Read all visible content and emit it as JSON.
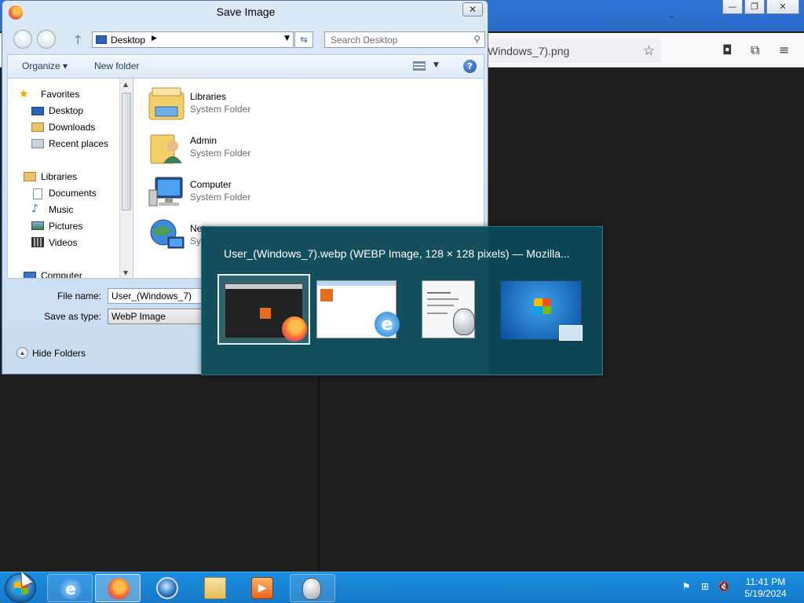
{
  "browser": {
    "url_text": "Windows_7).png",
    "icons": [
      "star-icon",
      "pocket-icon",
      "extensions-icon",
      "menu-icon"
    ]
  },
  "dialog": {
    "title": "Save Image",
    "address": "Desktop",
    "search_placeholder": "Search Desktop",
    "toolbar": {
      "organize": "Organize",
      "new_folder": "New folder"
    },
    "nav": {
      "favorites": "Favorites",
      "desktop": "Desktop",
      "downloads": "Downloads",
      "recent_places": "Recent places",
      "libraries": "Libraries",
      "documents": "Documents",
      "music": "Music",
      "pictures": "Pictures",
      "videos": "Videos",
      "computer": "Computer"
    },
    "files": [
      {
        "name": "Libraries",
        "type": "System Folder"
      },
      {
        "name": "Admin",
        "type": "System Folder"
      },
      {
        "name": "Computer",
        "type": "System Folder"
      },
      {
        "name": "Netw",
        "type": "Sys"
      }
    ],
    "file_name_label": "File name:",
    "file_name_value": "User_(Windows_7)",
    "save_as_label": "Save as type:",
    "save_as_value": "WebP Image",
    "hide_folders": "Hide Folders"
  },
  "thumbnail_popup": {
    "title": "User_(Windows_7).webp (WEBP Image, 128 × 128 pixels) — Mozilla..."
  },
  "taskbar": {
    "apps": [
      "internet-explorer",
      "firefox",
      "browser-globe",
      "file-explorer",
      "media-player",
      "mouse-app"
    ],
    "time": "11:41 PM",
    "date": "5/19/2024"
  },
  "colors": {
    "taskbar": "#1a8de0",
    "popup": "#0b4856",
    "dialog": "#dce9f7"
  }
}
